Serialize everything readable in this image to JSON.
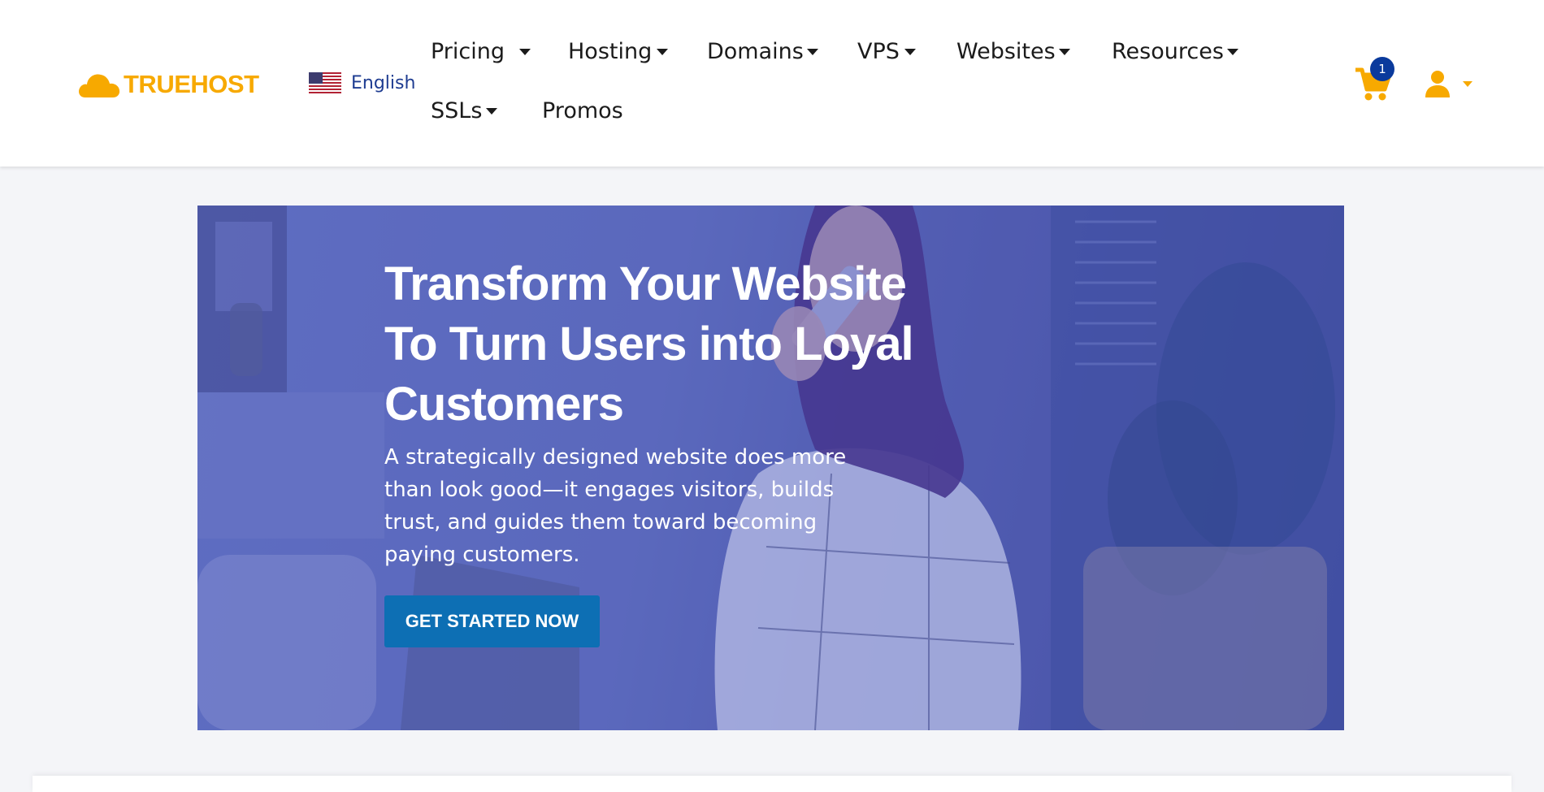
{
  "brand": {
    "name": "TRUEHOST",
    "color": "#f7a900"
  },
  "language": {
    "label": "English",
    "flag_icon": "us-flag-icon"
  },
  "nav": {
    "pricing": "Pricing",
    "hosting": "Hosting",
    "domains": "Domains",
    "vps": "VPS",
    "websites": "Websites",
    "resources": "Resources",
    "ssls": "SSLs",
    "promos": "Promos"
  },
  "cart": {
    "count": "1",
    "icon": "cart-icon"
  },
  "user": {
    "icon": "user-icon"
  },
  "hero": {
    "title": "Transform Your Website To Turn Users into Loyal Customers",
    "subtitle": "A strategically designed website does more than look good—it engages visitors, builds trust, and guides them toward becoming paying customers.",
    "cta_label": "GET STARTED NOW"
  },
  "colors": {
    "accent": "#f7a900",
    "cta": "#0d6fb4",
    "badge": "#0a3a9c",
    "hero_overlay": "#4050be"
  }
}
